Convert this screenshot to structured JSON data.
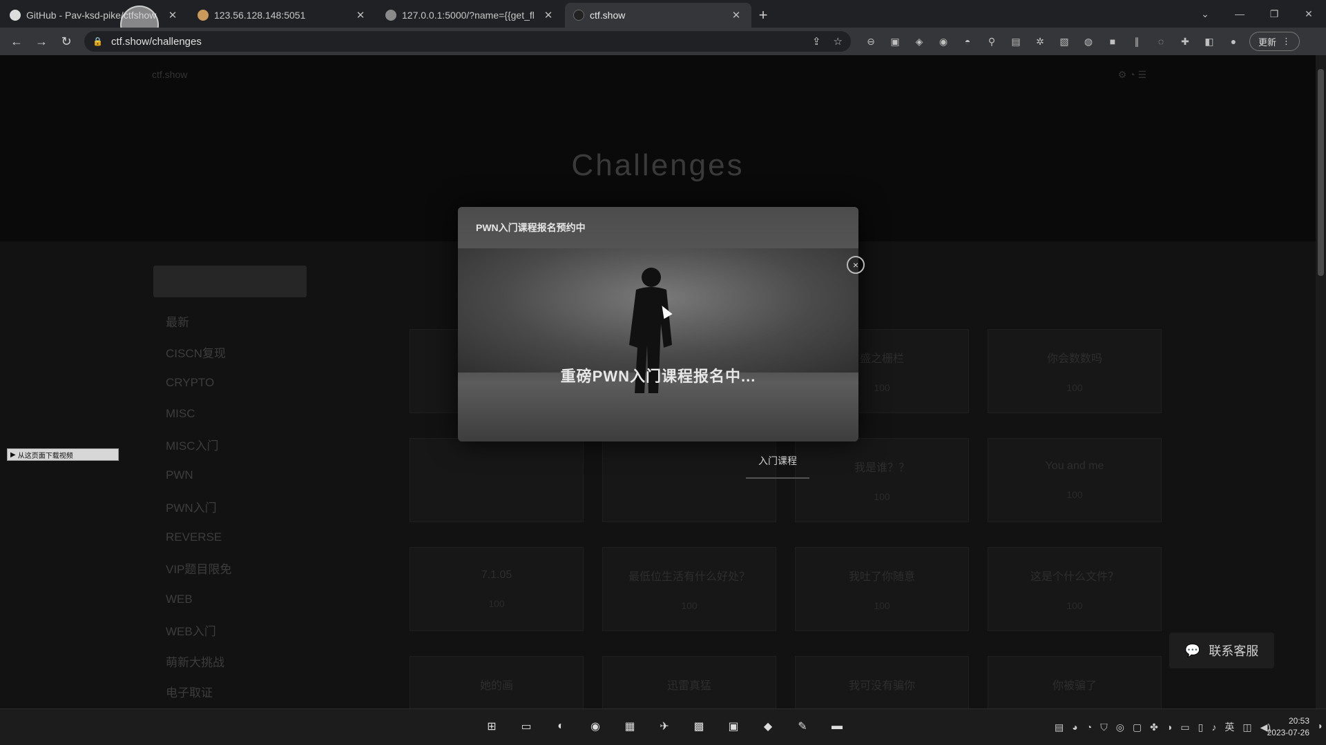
{
  "browser": {
    "tabs": [
      {
        "title": "GitHub - Pav-ksd-pike/ctfshow",
        "active": false
      },
      {
        "title": "123.56.128.148:5051",
        "active": false
      },
      {
        "title": "127.0.0.1:5000/?name={{get_fl",
        "active": false
      },
      {
        "title": "ctf.show",
        "active": true
      }
    ],
    "new_tab": "+",
    "url": "ctf.show/challenges",
    "update_label": "更新"
  },
  "site": {
    "hero_title": "Challenges",
    "nav_left": "ctf.show",
    "categories": [
      "最新",
      "CISCN复现",
      "CRYPTO",
      "MISC",
      "MISC入门",
      "PWN",
      "PWN入门",
      "REVERSE",
      "VIP题目限免",
      "WEB",
      "WEB入门",
      "萌新大挑战",
      "电子取证"
    ],
    "challenges": [
      {
        "name": "",
        "score": ""
      },
      {
        "name": "",
        "score": ""
      },
      {
        "name": "盛之栅栏",
        "score": "100"
      },
      {
        "name": "你会数数吗",
        "score": "100"
      },
      {
        "name": "",
        "score": ""
      },
      {
        "name": "",
        "score": ""
      },
      {
        "name": "我是谁？？",
        "score": "100"
      },
      {
        "name": "You and me",
        "score": "100"
      },
      {
        "name": "7.1.05",
        "score": "100"
      },
      {
        "name": "最低位生活有什么好处？",
        "score": "100"
      },
      {
        "name": "我吐了你随意",
        "score": "100"
      },
      {
        "name": "这是个什么文件？",
        "score": "100"
      },
      {
        "name": "她的画",
        "score": "100"
      },
      {
        "name": "迅雷真猛",
        "score": "100"
      },
      {
        "name": "我可没有骗你",
        "score": "100"
      },
      {
        "name": "你被骗了",
        "score": "100"
      }
    ],
    "contact_label": "联系客服",
    "download_bar": "从这页面下载视频"
  },
  "modal": {
    "small_title": "PWN入门课程报名预约中",
    "big_title": "重磅PWN入门课程报名中...",
    "close": "×",
    "course_tab": "入门课程"
  },
  "taskbar": {
    "time": "20:53",
    "date": "2023-07-26",
    "ime": "英"
  }
}
